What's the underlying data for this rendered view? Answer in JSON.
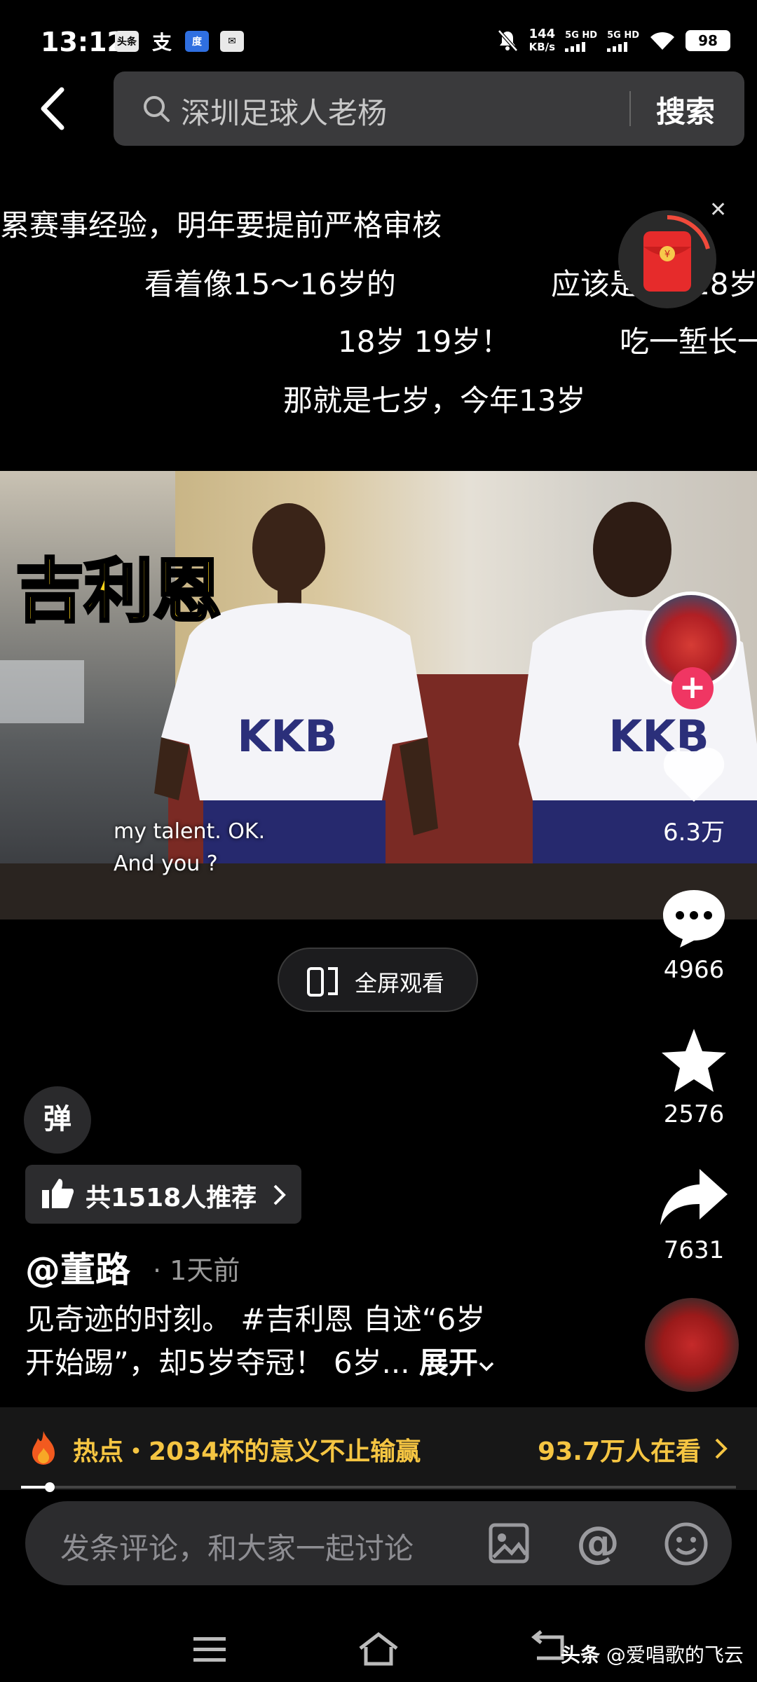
{
  "status_bar": {
    "time": "13:12",
    "apps": [
      "头条",
      "支",
      "度",
      "✉"
    ],
    "network_speed": "144",
    "network_unit": "KB/s",
    "signal_1": "5G HD",
    "signal_2": "5G HD",
    "battery": "98"
  },
  "search": {
    "query": "深圳足球人老杨",
    "button": "搜索"
  },
  "danmaku": [
    "累赛事经验，明年要提前严格审核",
    "看着像15～16岁的",
    "应该是",
    "18岁",
    "18岁 19岁！",
    "吃一堑长一",
    "那就是七岁，今年13岁"
  ],
  "video": {
    "overlay_name": "吉利恩",
    "subtitle_line1": "my talent.  OK.",
    "subtitle_line2": "And you ?",
    "fullscreen_label": "全屏观看"
  },
  "actions": {
    "likes": "6.3万",
    "comments": "4966",
    "favorites": "2576",
    "shares": "7631",
    "follow": "+"
  },
  "danmaku_toggle": "弹",
  "recommend": {
    "label": "共1518人推荐"
  },
  "post": {
    "author": "@董路",
    "time": "1天前",
    "desc_line1": "见奇迹的时刻。 #吉利恩 自述“6岁",
    "desc_line2": "开始踢”，却5岁夺冠！ 6岁...",
    "expand": "展开"
  },
  "hot": {
    "text": "热点・2034杯的意义不止输赢",
    "count": "93.7万人在看"
  },
  "progress": 0.04,
  "comment": {
    "placeholder": "发条评论，和大家一起讨论"
  },
  "watermark": {
    "brand": "头条",
    "user": "@爱唱歌的飞云"
  },
  "colors": {
    "hot": "#f5c542",
    "follow": "#f03663",
    "overlay_name": "#ffd51a"
  }
}
